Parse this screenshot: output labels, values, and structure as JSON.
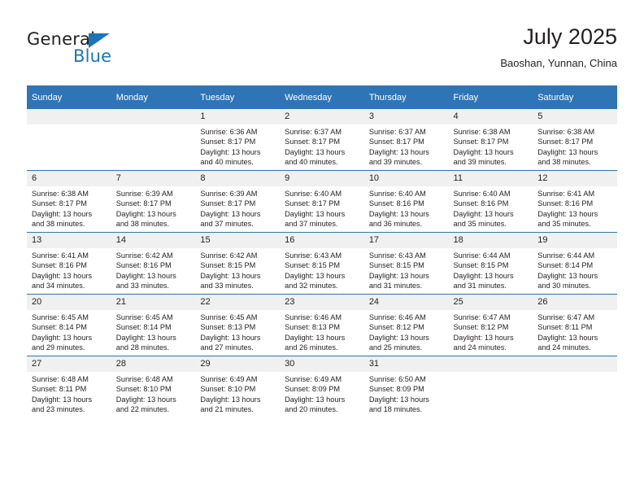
{
  "brand": {
    "word1": "General",
    "word2": "Blue",
    "triangle_color": "#1b75bb",
    "text_color": "#231f20"
  },
  "header": {
    "title": "July 2025",
    "location": "Baoshan, Yunnan, China"
  },
  "theme": {
    "header_bg": "#2f75b5",
    "header_text": "#ffffff",
    "daynum_bg": "#f0f0f0",
    "cell_bg": "#ffffff",
    "body_text": "#231f20"
  },
  "calendar": {
    "weekdays": [
      "Sunday",
      "Monday",
      "Tuesday",
      "Wednesday",
      "Thursday",
      "Friday",
      "Saturday"
    ],
    "weeks": [
      [
        {
          "day": "",
          "lines": []
        },
        {
          "day": "",
          "lines": []
        },
        {
          "day": "1",
          "lines": [
            "Sunrise: 6:36 AM",
            "Sunset: 8:17 PM",
            "Daylight: 13 hours",
            "and 40 minutes."
          ]
        },
        {
          "day": "2",
          "lines": [
            "Sunrise: 6:37 AM",
            "Sunset: 8:17 PM",
            "Daylight: 13 hours",
            "and 40 minutes."
          ]
        },
        {
          "day": "3",
          "lines": [
            "Sunrise: 6:37 AM",
            "Sunset: 8:17 PM",
            "Daylight: 13 hours",
            "and 39 minutes."
          ]
        },
        {
          "day": "4",
          "lines": [
            "Sunrise: 6:38 AM",
            "Sunset: 8:17 PM",
            "Daylight: 13 hours",
            "and 39 minutes."
          ]
        },
        {
          "day": "5",
          "lines": [
            "Sunrise: 6:38 AM",
            "Sunset: 8:17 PM",
            "Daylight: 13 hours",
            "and 38 minutes."
          ]
        }
      ],
      [
        {
          "day": "6",
          "lines": [
            "Sunrise: 6:38 AM",
            "Sunset: 8:17 PM",
            "Daylight: 13 hours",
            "and 38 minutes."
          ]
        },
        {
          "day": "7",
          "lines": [
            "Sunrise: 6:39 AM",
            "Sunset: 8:17 PM",
            "Daylight: 13 hours",
            "and 38 minutes."
          ]
        },
        {
          "day": "8",
          "lines": [
            "Sunrise: 6:39 AM",
            "Sunset: 8:17 PM",
            "Daylight: 13 hours",
            "and 37 minutes."
          ]
        },
        {
          "day": "9",
          "lines": [
            "Sunrise: 6:40 AM",
            "Sunset: 8:17 PM",
            "Daylight: 13 hours",
            "and 37 minutes."
          ]
        },
        {
          "day": "10",
          "lines": [
            "Sunrise: 6:40 AM",
            "Sunset: 8:16 PM",
            "Daylight: 13 hours",
            "and 36 minutes."
          ]
        },
        {
          "day": "11",
          "lines": [
            "Sunrise: 6:40 AM",
            "Sunset: 8:16 PM",
            "Daylight: 13 hours",
            "and 35 minutes."
          ]
        },
        {
          "day": "12",
          "lines": [
            "Sunrise: 6:41 AM",
            "Sunset: 8:16 PM",
            "Daylight: 13 hours",
            "and 35 minutes."
          ]
        }
      ],
      [
        {
          "day": "13",
          "lines": [
            "Sunrise: 6:41 AM",
            "Sunset: 8:16 PM",
            "Daylight: 13 hours",
            "and 34 minutes."
          ]
        },
        {
          "day": "14",
          "lines": [
            "Sunrise: 6:42 AM",
            "Sunset: 8:16 PM",
            "Daylight: 13 hours",
            "and 33 minutes."
          ]
        },
        {
          "day": "15",
          "lines": [
            "Sunrise: 6:42 AM",
            "Sunset: 8:15 PM",
            "Daylight: 13 hours",
            "and 33 minutes."
          ]
        },
        {
          "day": "16",
          "lines": [
            "Sunrise: 6:43 AM",
            "Sunset: 8:15 PM",
            "Daylight: 13 hours",
            "and 32 minutes."
          ]
        },
        {
          "day": "17",
          "lines": [
            "Sunrise: 6:43 AM",
            "Sunset: 8:15 PM",
            "Daylight: 13 hours",
            "and 31 minutes."
          ]
        },
        {
          "day": "18",
          "lines": [
            "Sunrise: 6:44 AM",
            "Sunset: 8:15 PM",
            "Daylight: 13 hours",
            "and 31 minutes."
          ]
        },
        {
          "day": "19",
          "lines": [
            "Sunrise: 6:44 AM",
            "Sunset: 8:14 PM",
            "Daylight: 13 hours",
            "and 30 minutes."
          ]
        }
      ],
      [
        {
          "day": "20",
          "lines": [
            "Sunrise: 6:45 AM",
            "Sunset: 8:14 PM",
            "Daylight: 13 hours",
            "and 29 minutes."
          ]
        },
        {
          "day": "21",
          "lines": [
            "Sunrise: 6:45 AM",
            "Sunset: 8:14 PM",
            "Daylight: 13 hours",
            "and 28 minutes."
          ]
        },
        {
          "day": "22",
          "lines": [
            "Sunrise: 6:45 AM",
            "Sunset: 8:13 PM",
            "Daylight: 13 hours",
            "and 27 minutes."
          ]
        },
        {
          "day": "23",
          "lines": [
            "Sunrise: 6:46 AM",
            "Sunset: 8:13 PM",
            "Daylight: 13 hours",
            "and 26 minutes."
          ]
        },
        {
          "day": "24",
          "lines": [
            "Sunrise: 6:46 AM",
            "Sunset: 8:12 PM",
            "Daylight: 13 hours",
            "and 25 minutes."
          ]
        },
        {
          "day": "25",
          "lines": [
            "Sunrise: 6:47 AM",
            "Sunset: 8:12 PM",
            "Daylight: 13 hours",
            "and 24 minutes."
          ]
        },
        {
          "day": "26",
          "lines": [
            "Sunrise: 6:47 AM",
            "Sunset: 8:11 PM",
            "Daylight: 13 hours",
            "and 24 minutes."
          ]
        }
      ],
      [
        {
          "day": "27",
          "lines": [
            "Sunrise: 6:48 AM",
            "Sunset: 8:11 PM",
            "Daylight: 13 hours",
            "and 23 minutes."
          ]
        },
        {
          "day": "28",
          "lines": [
            "Sunrise: 6:48 AM",
            "Sunset: 8:10 PM",
            "Daylight: 13 hours",
            "and 22 minutes."
          ]
        },
        {
          "day": "29",
          "lines": [
            "Sunrise: 6:49 AM",
            "Sunset: 8:10 PM",
            "Daylight: 13 hours",
            "and 21 minutes."
          ]
        },
        {
          "day": "30",
          "lines": [
            "Sunrise: 6:49 AM",
            "Sunset: 8:09 PM",
            "Daylight: 13 hours",
            "and 20 minutes."
          ]
        },
        {
          "day": "31",
          "lines": [
            "Sunrise: 6:50 AM",
            "Sunset: 8:09 PM",
            "Daylight: 13 hours",
            "and 18 minutes."
          ]
        },
        {
          "day": "",
          "lines": []
        },
        {
          "day": "",
          "lines": []
        }
      ]
    ]
  }
}
